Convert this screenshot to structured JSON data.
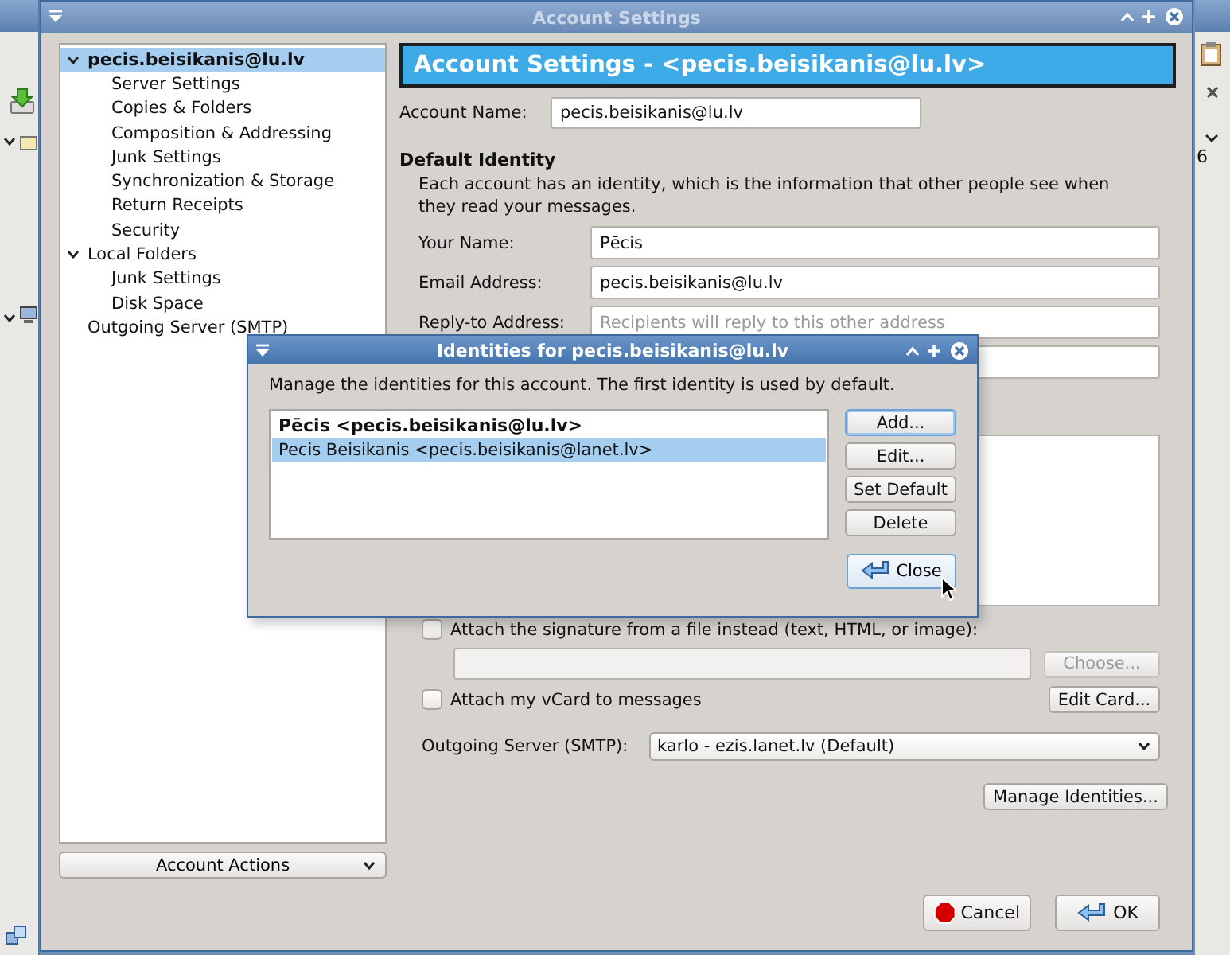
{
  "background_window": {
    "partial_text": "6"
  },
  "window": {
    "title": "Account Settings",
    "active": false
  },
  "sidebar": {
    "items": [
      {
        "label": "pecis.beisikanis@lu.lv",
        "selected": true,
        "expanded": true,
        "children": [
          {
            "label": "Server Settings",
            "selected": false
          },
          {
            "label": "Copies & Folders",
            "selected": false
          },
          {
            "label": "Composition & Addressing",
            "selected": false
          },
          {
            "label": "Junk Settings",
            "selected": false
          },
          {
            "label": "Synchronization & Storage",
            "selected": false
          },
          {
            "label": "Return Receipts",
            "selected": false
          },
          {
            "label": "Security",
            "selected": false
          }
        ]
      },
      {
        "label": "Local Folders",
        "selected": false,
        "expanded": true,
        "children": [
          {
            "label": "Junk Settings",
            "selected": false
          },
          {
            "label": "Disk Space",
            "selected": false
          }
        ]
      },
      {
        "label": "Outgoing Server (SMTP)",
        "selected": false
      }
    ],
    "account_actions": "Account Actions"
  },
  "panel": {
    "header": "Account Settings - <pecis.beisikanis@lu.lv>",
    "account_name": {
      "label": "Account Name:",
      "value": "pecis.beisikanis@lu.lv"
    },
    "default_identity": {
      "heading": "Default Identity",
      "description": "Each account has an identity, which is the information that other people see when they read your messages.",
      "fields": [
        {
          "label": "Your Name:",
          "value": "Pēcis"
        },
        {
          "label": "Email Address:",
          "value": "pecis.beisikanis@lu.lv"
        },
        {
          "label": "Reply-to Address:",
          "placeholder": "Recipients will reply to this other address"
        }
      ]
    },
    "signature_file": {
      "label": "Attach the signature from a file instead (text, HTML, or image):",
      "checked": false,
      "choose_button": {
        "label": "Choose...",
        "disabled": true
      }
    },
    "vcard": {
      "label": "Attach my vCard to messages",
      "checked": false,
      "edit_button": "Edit Card..."
    },
    "outgoing_server": {
      "label": "Outgoing Server (SMTP):",
      "value": "karlo - ezis.lanet.lv (Default)"
    },
    "manage_identities": "Manage Identities..."
  },
  "buttons": [
    {
      "label": "Cancel",
      "kind": "cancel"
    },
    {
      "label": "OK",
      "kind": "ok"
    }
  ],
  "identities_dialog": {
    "title": "Identities for pecis.beisikanis@lu.lv",
    "description": "Manage the identities for this account. The first identity is used by default.",
    "identities": [
      {
        "label": "Pēcis <pecis.beisikanis@lu.lv>",
        "selected": false,
        "default": true
      },
      {
        "label": "Pecis Beisikanis <pecis.beisikanis@lanet.lv>",
        "selected": true,
        "default": false
      }
    ],
    "buttons": [
      {
        "label": "Add...",
        "focused": true
      },
      {
        "label": "Edit...",
        "focused": false
      },
      {
        "label": "Set Default",
        "focused": false
      },
      {
        "label": "Delete",
        "focused": false
      }
    ],
    "close": "Close"
  }
}
